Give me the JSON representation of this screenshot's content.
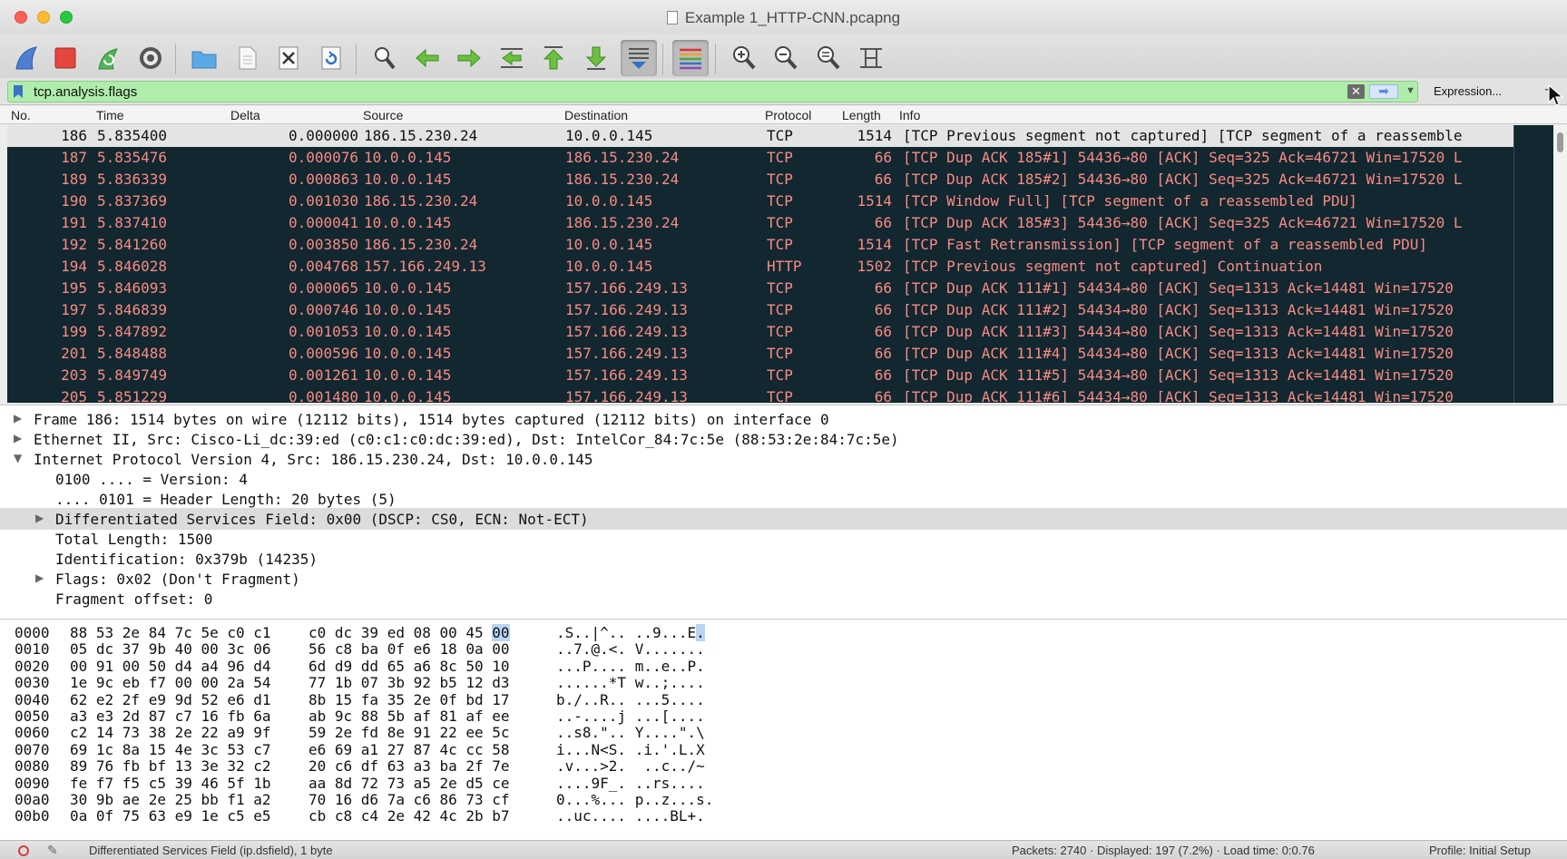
{
  "window": {
    "title": "Example 1_HTTP-CNN.pcapng"
  },
  "toolbar": {
    "buttons": [
      {
        "name": "start-capture-icon"
      },
      {
        "name": "stop-capture-icon"
      },
      {
        "name": "restart-capture-icon"
      },
      {
        "name": "capture-options-icon"
      },
      {
        "name": "open-file-icon"
      },
      {
        "name": "save-file-icon"
      },
      {
        "name": "close-file-icon"
      },
      {
        "name": "reload-file-icon"
      },
      {
        "name": "find-packet-icon"
      },
      {
        "name": "go-back-icon"
      },
      {
        "name": "go-forward-icon"
      },
      {
        "name": "go-to-packet-icon"
      },
      {
        "name": "go-first-icon"
      },
      {
        "name": "go-last-icon"
      },
      {
        "name": "autoscroll-icon"
      },
      {
        "name": "colorize-icon"
      },
      {
        "name": "zoom-in-icon"
      },
      {
        "name": "zoom-out-icon"
      },
      {
        "name": "zoom-normal-icon"
      },
      {
        "name": "resize-columns-icon"
      }
    ]
  },
  "filter": {
    "value": "tcp.analysis.flags",
    "expression_label": "Expression...",
    "clear_glyph": "✕",
    "apply_glyph": "➡",
    "dropdown_glyph": "▼",
    "plus_glyph": "+"
  },
  "packet_list": {
    "columns": {
      "no": "No.",
      "time": "Time",
      "delta": "Delta",
      "source": "Source",
      "destination": "Destination",
      "protocol": "Protocol",
      "length": "Length",
      "info": "Info"
    },
    "rows": [
      {
        "no": "186",
        "time": "5.835400",
        "delta": "0.000000",
        "source": "186.15.230.24",
        "destination": "10.0.0.145",
        "protocol": "TCP",
        "length": "1514",
        "info": "[TCP Previous segment not captured] [TCP segment of a reassemble"
      },
      {
        "no": "187",
        "time": "5.835476",
        "delta": "0.000076",
        "source": "10.0.0.145",
        "destination": "186.15.230.24",
        "protocol": "TCP",
        "length": "66",
        "info": "[TCP Dup ACK 185#1] 54436→80 [ACK] Seq=325 Ack=46721 Win=17520 L"
      },
      {
        "no": "189",
        "time": "5.836339",
        "delta": "0.000863",
        "source": "10.0.0.145",
        "destination": "186.15.230.24",
        "protocol": "TCP",
        "length": "66",
        "info": "[TCP Dup ACK 185#2] 54436→80 [ACK] Seq=325 Ack=46721 Win=17520 L"
      },
      {
        "no": "190",
        "time": "5.837369",
        "delta": "0.001030",
        "source": "186.15.230.24",
        "destination": "10.0.0.145",
        "protocol": "TCP",
        "length": "1514",
        "info": "[TCP Window Full] [TCP segment of a reassembled PDU]"
      },
      {
        "no": "191",
        "time": "5.837410",
        "delta": "0.000041",
        "source": "10.0.0.145",
        "destination": "186.15.230.24",
        "protocol": "TCP",
        "length": "66",
        "info": "[TCP Dup ACK 185#3] 54436→80 [ACK] Seq=325 Ack=46721 Win=17520 L"
      },
      {
        "no": "192",
        "time": "5.841260",
        "delta": "0.003850",
        "source": "186.15.230.24",
        "destination": "10.0.0.145",
        "protocol": "TCP",
        "length": "1514",
        "info": "[TCP Fast Retransmission] [TCP segment of a reassembled PDU]"
      },
      {
        "no": "194",
        "time": "5.846028",
        "delta": "0.004768",
        "source": "157.166.249.13",
        "destination": "10.0.0.145",
        "protocol": "HTTP",
        "length": "1502",
        "info": "[TCP Previous segment not captured] Continuation"
      },
      {
        "no": "195",
        "time": "5.846093",
        "delta": "0.000065",
        "source": "10.0.0.145",
        "destination": "157.166.249.13",
        "protocol": "TCP",
        "length": "66",
        "info": "[TCP Dup ACK 111#1] 54434→80 [ACK] Seq=1313 Ack=14481 Win=17520"
      },
      {
        "no": "197",
        "time": "5.846839",
        "delta": "0.000746",
        "source": "10.0.0.145",
        "destination": "157.166.249.13",
        "protocol": "TCP",
        "length": "66",
        "info": "[TCP Dup ACK 111#2] 54434→80 [ACK] Seq=1313 Ack=14481 Win=17520"
      },
      {
        "no": "199",
        "time": "5.847892",
        "delta": "0.001053",
        "source": "10.0.0.145",
        "destination": "157.166.249.13",
        "protocol": "TCP",
        "length": "66",
        "info": "[TCP Dup ACK 111#3] 54434→80 [ACK] Seq=1313 Ack=14481 Win=17520"
      },
      {
        "no": "201",
        "time": "5.848488",
        "delta": "0.000596",
        "source": "10.0.0.145",
        "destination": "157.166.249.13",
        "protocol": "TCP",
        "length": "66",
        "info": "[TCP Dup ACK 111#4] 54434→80 [ACK] Seq=1313 Ack=14481 Win=17520"
      },
      {
        "no": "203",
        "time": "5.849749",
        "delta": "0.001261",
        "source": "10.0.0.145",
        "destination": "157.166.249.13",
        "protocol": "TCP",
        "length": "66",
        "info": "[TCP Dup ACK 111#5] 54434→80 [ACK] Seq=1313 Ack=14481 Win=17520"
      },
      {
        "no": "205",
        "time": "5.851229",
        "delta": "0.001480",
        "source": "10.0.0.145",
        "destination": "157.166.249.13",
        "protocol": "TCP",
        "length": "66",
        "info": "[TCP Dup ACK 111#6] 54434→80 [ACK] Seq=1313 Ack=14481 Win=17520"
      }
    ]
  },
  "details": {
    "rows": [
      {
        "text": "Frame 186: 1514 bytes on wire (12112 bits), 1514 bytes captured (12112 bits) on interface 0",
        "tri": "▶",
        "indent": 0
      },
      {
        "text": "Ethernet II, Src: Cisco-Li_dc:39:ed (c0:c1:c0:dc:39:ed), Dst: IntelCor_84:7c:5e (88:53:2e:84:7c:5e)",
        "tri": "▶",
        "indent": 0
      },
      {
        "text": "Internet Protocol Version 4, Src: 186.15.230.24, Dst: 10.0.0.145",
        "tri": "▼",
        "indent": 0
      },
      {
        "text": "0100 .... = Version: 4",
        "tri": "",
        "indent": 1
      },
      {
        "text": ".... 0101 = Header Length: 20 bytes (5)",
        "tri": "",
        "indent": 1
      },
      {
        "text": "Differentiated Services Field: 0x00 (DSCP: CS0, ECN: Not-ECT)",
        "tri": "▶",
        "indent": 1
      },
      {
        "text": "Total Length: 1500",
        "tri": "",
        "indent": 1
      },
      {
        "text": "Identification: 0x379b (14235)",
        "tri": "",
        "indent": 1
      },
      {
        "text": "Flags: 0x02 (Don't Fragment)",
        "tri": "▶",
        "indent": 1
      },
      {
        "text": "Fragment offset: 0",
        "tri": "",
        "indent": 1
      }
    ]
  },
  "bytes": {
    "rows": [
      {
        "offset": "0000",
        "hex1": "88 53 2e 84 7c 5e c0 c1",
        "hex2": "c0 dc 39 ed 08 00 45 00",
        "ascii": ".S..|^.. ..9...E."
      },
      {
        "offset": "0010",
        "hex1": "05 dc 37 9b 40 00 3c 06",
        "hex2": "56 c8 ba 0f e6 18 0a 00",
        "ascii": "..7.@.<. V......."
      },
      {
        "offset": "0020",
        "hex1": "00 91 00 50 d4 a4 96 d4",
        "hex2": "6d d9 dd 65 a6 8c 50 10",
        "ascii": "...P.... m..e..P."
      },
      {
        "offset": "0030",
        "hex1": "1e 9c eb f7 00 00 2a 54",
        "hex2": "77 1b 07 3b 92 b5 12 d3",
        "ascii": "......*T w..;...."
      },
      {
        "offset": "0040",
        "hex1": "62 e2 2f e9 9d 52 e6 d1",
        "hex2": "8b 15 fa 35 2e 0f bd 17",
        "ascii": "b./..R.. ...5...."
      },
      {
        "offset": "0050",
        "hex1": "a3 e3 2d 87 c7 16 fb 6a",
        "hex2": "ab 9c 88 5b af 81 af ee",
        "ascii": "..-....j ...[...."
      },
      {
        "offset": "0060",
        "hex1": "c2 14 73 38 2e 22 a9 9f",
        "hex2": "59 2e fd 8e 91 22 ee 5c",
        "ascii": "..s8.\".. Y....\".\\"
      },
      {
        "offset": "0070",
        "hex1": "69 1c 8a 15 4e 3c 53 c7",
        "hex2": "e6 69 a1 27 87 4c cc 58",
        "ascii": "i...N<S. .i.'.L.X"
      },
      {
        "offset": "0080",
        "hex1": "89 76 fb bf 13 3e 32 c2",
        "hex2": "20 c6 df 63 a3 ba 2f 7e",
        "ascii": ".v...>2.  ..c../~"
      },
      {
        "offset": "0090",
        "hex1": "fe f7 f5 c5 39 46 5f 1b",
        "hex2": "aa 8d 72 73 a5 2e d5 ce",
        "ascii": "....9F_. ..rs...."
      },
      {
        "offset": "00a0",
        "hex1": "30 9b ae 2e 25 bb f1 a2",
        "hex2": "70 16 d6 7a c6 86 73 cf",
        "ascii": "0...%... p..z...s."
      },
      {
        "offset": "00b0",
        "hex1": "0a 0f 75 63 e9 1e c5 e5",
        "hex2": "cb c8 c4 2e 42 4c 2b b7",
        "ascii": "..uc.... ....BL+."
      }
    ]
  },
  "status": {
    "field_info": "Differentiated Services Field (ip.dsfield), 1 byte",
    "packets": "Packets: 2740 · Displayed: 197 (7.2%) · Load time: 0:0.76",
    "profile": "Profile: Initial Setup"
  },
  "colors": {
    "bad_tcp_bg": "#12272f",
    "bad_tcp_fg": "#f78b84",
    "filter_valid": "#afedaa"
  }
}
